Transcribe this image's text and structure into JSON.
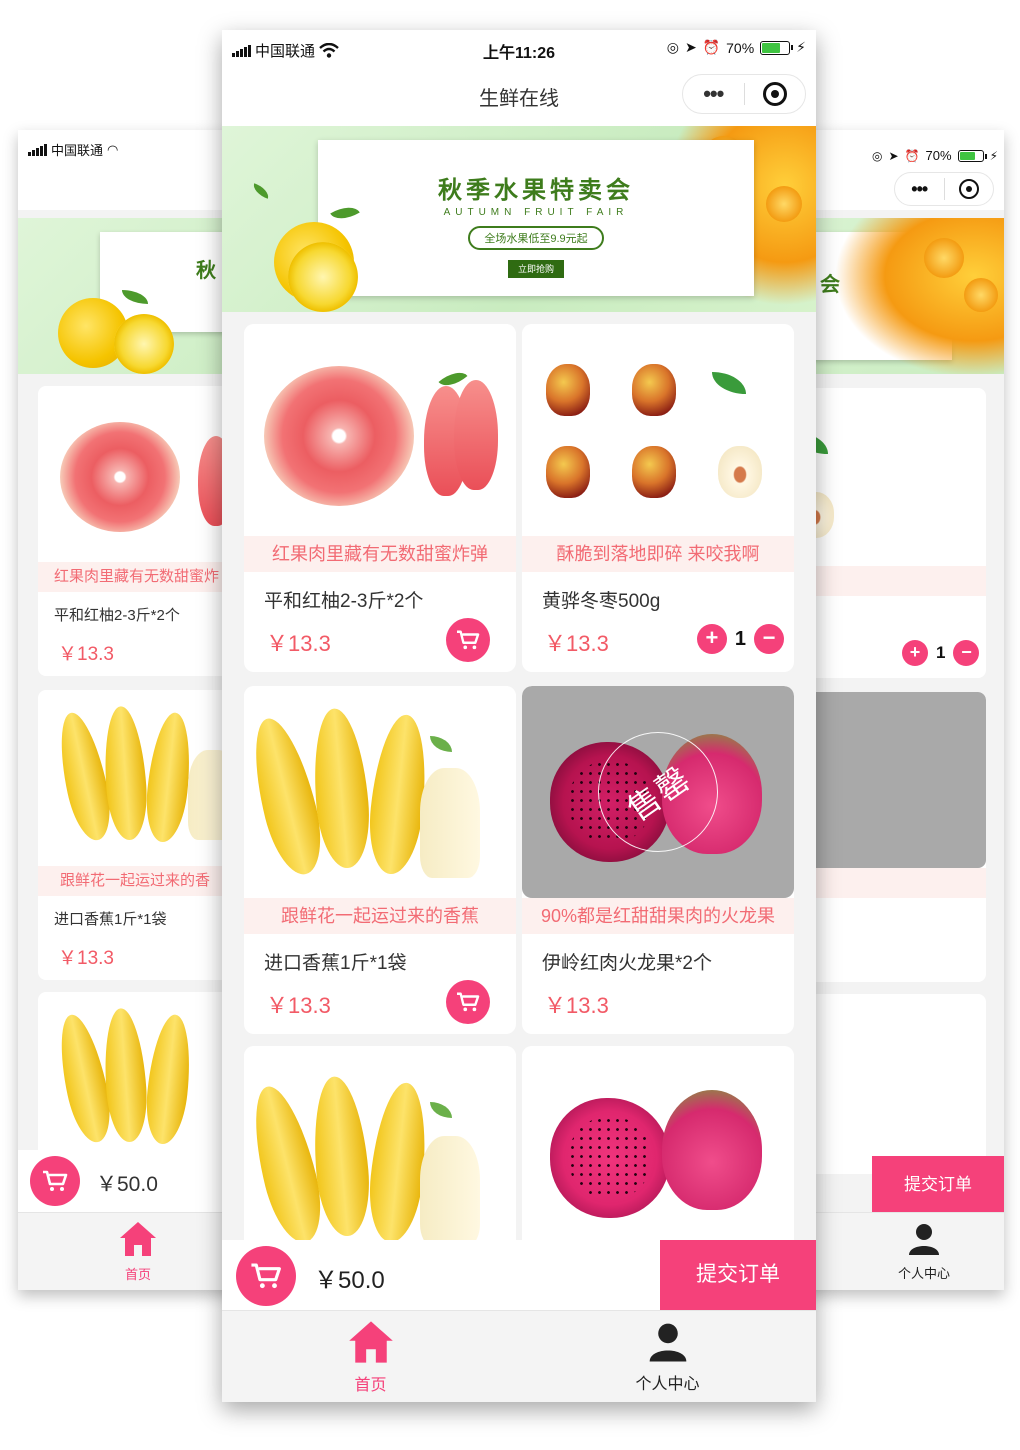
{
  "status": {
    "carrier": "中国联通",
    "time": "上午11:26",
    "battery": "70%"
  },
  "navbar": {
    "title": "生鲜在线",
    "more_icon": "•••"
  },
  "banner": {
    "title": "秋季水果特卖会",
    "subtitle": "AUTUMN FRUIT FAIR",
    "pill": "全场水果低至9.9元起",
    "button": "立即抢购"
  },
  "products": [
    {
      "slogan": "红果肉里藏有无数甜蜜炸弹",
      "name": "平和红柚2-3斤*2个",
      "price": "￥13.3",
      "action": "cart"
    },
    {
      "slogan": "酥脆到落地即碎 来咬我啊",
      "name": "黄骅冬枣500g",
      "price": "￥13.3",
      "action": "stepper",
      "qty": "1"
    },
    {
      "slogan": "跟鲜花一起运过来的香蕉",
      "name": "进口香蕉1斤*1袋",
      "price": "￥13.3",
      "action": "cart"
    },
    {
      "slogan": "90%都是红甜甜果肉的火龙果",
      "name": "伊岭红肉火龙果*2个",
      "price": "￥13.3",
      "action": "none",
      "sold_out": "售罄"
    }
  ],
  "back_left": {
    "carrier": "中国联通",
    "banner_fragment": "秋",
    "p1_slogan": "红果肉里藏有无数甜蜜炸",
    "p1_name": "平和红柚2-3斤*2个",
    "p1_price": "￥13.3",
    "p2_slogan": "跟鲜花一起运过来的香",
    "p2_name": "进口香蕉1斤*1袋",
    "p2_price": "￥13.3",
    "total": "￥50.0",
    "tab_home": "首页"
  },
  "back_right": {
    "battery": "70%",
    "banner_fragment": "会",
    "p1_slogan": "到落地即碎 来咬我啊",
    "p1_name": "枣500g",
    "p1_price": ".3",
    "p1_qty": "1",
    "sold_out": "售罄",
    "p2_slogan": "是红甜甜果肉的火龙果",
    "p2_name": "肉火龙果*2个",
    "p2_price": ".3",
    "submit": "提交订单",
    "tab_profile": "个人中心"
  },
  "cart": {
    "total": "￥50.0",
    "submit": "提交订单"
  },
  "tabs": [
    {
      "label": "首页",
      "icon": "home-icon",
      "active": true
    },
    {
      "label": "个人中心",
      "icon": "user-icon",
      "active": false
    }
  ],
  "colors": {
    "accent": "#f5417a",
    "price": "#f25a66",
    "slogan_bg": "#fdf0ee",
    "banner_green": "#3e7c1c"
  }
}
